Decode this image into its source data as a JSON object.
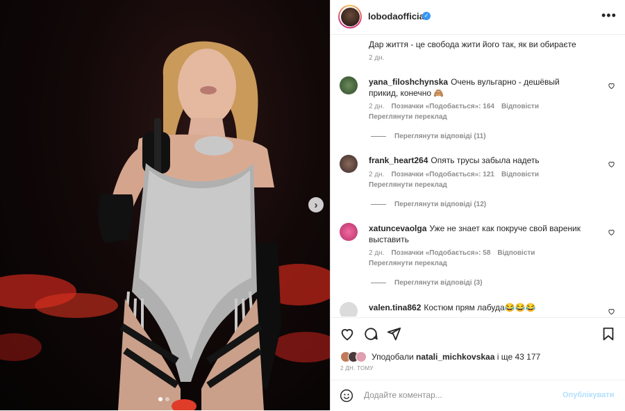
{
  "post": {
    "username": "lobodaofficial",
    "more_icon": "more-horizontal-icon",
    "caption": "Дар життя - це свобода жити його так, як ви обираєте",
    "caption_time": "2 дн."
  },
  "comments": [
    {
      "user": "yana_filoshchynska",
      "text": "Очень вульгарно - дешёвый прикид, конечно 🙈",
      "time": "2 дн.",
      "likes": "Позначки «Подобається»: 164",
      "reply": "Відповісти",
      "translate": "Переглянути переклад",
      "view_replies": "Переглянути відповіді (11)"
    },
    {
      "user": "frank_heart264",
      "text": "Опять трусы забыла надеть",
      "time": "2 дн.",
      "likes": "Позначки «Подобається»: 121",
      "reply": "Відповісти",
      "translate": "Переглянути переклад",
      "view_replies": "Переглянути відповіді (12)"
    },
    {
      "user": "xatuncevaolga",
      "text": "Уже не знает как покруче свой вареник выставить",
      "time": "2 дн.",
      "likes": "Позначки «Подобається»: 58",
      "reply": "Відповісти",
      "translate": "Переглянути переклад",
      "view_replies": "Переглянути відповіді (3)"
    },
    {
      "user": "valen.tina862",
      "text": "Костюм прям лабуда😂😂😂"
    }
  ],
  "likes": {
    "prefix": "Уподобали",
    "user": "natali_michkovskaa",
    "suffix": "і ще 43 177"
  },
  "post_time": "2 ДН. ТОМУ",
  "add_comment": {
    "placeholder": "Додайте коментар...",
    "publish": "Опублікувати"
  },
  "colors": {
    "accent": "#3897f0",
    "publish_disabled": "#b2dffc",
    "muted": "#8e8e8e"
  }
}
